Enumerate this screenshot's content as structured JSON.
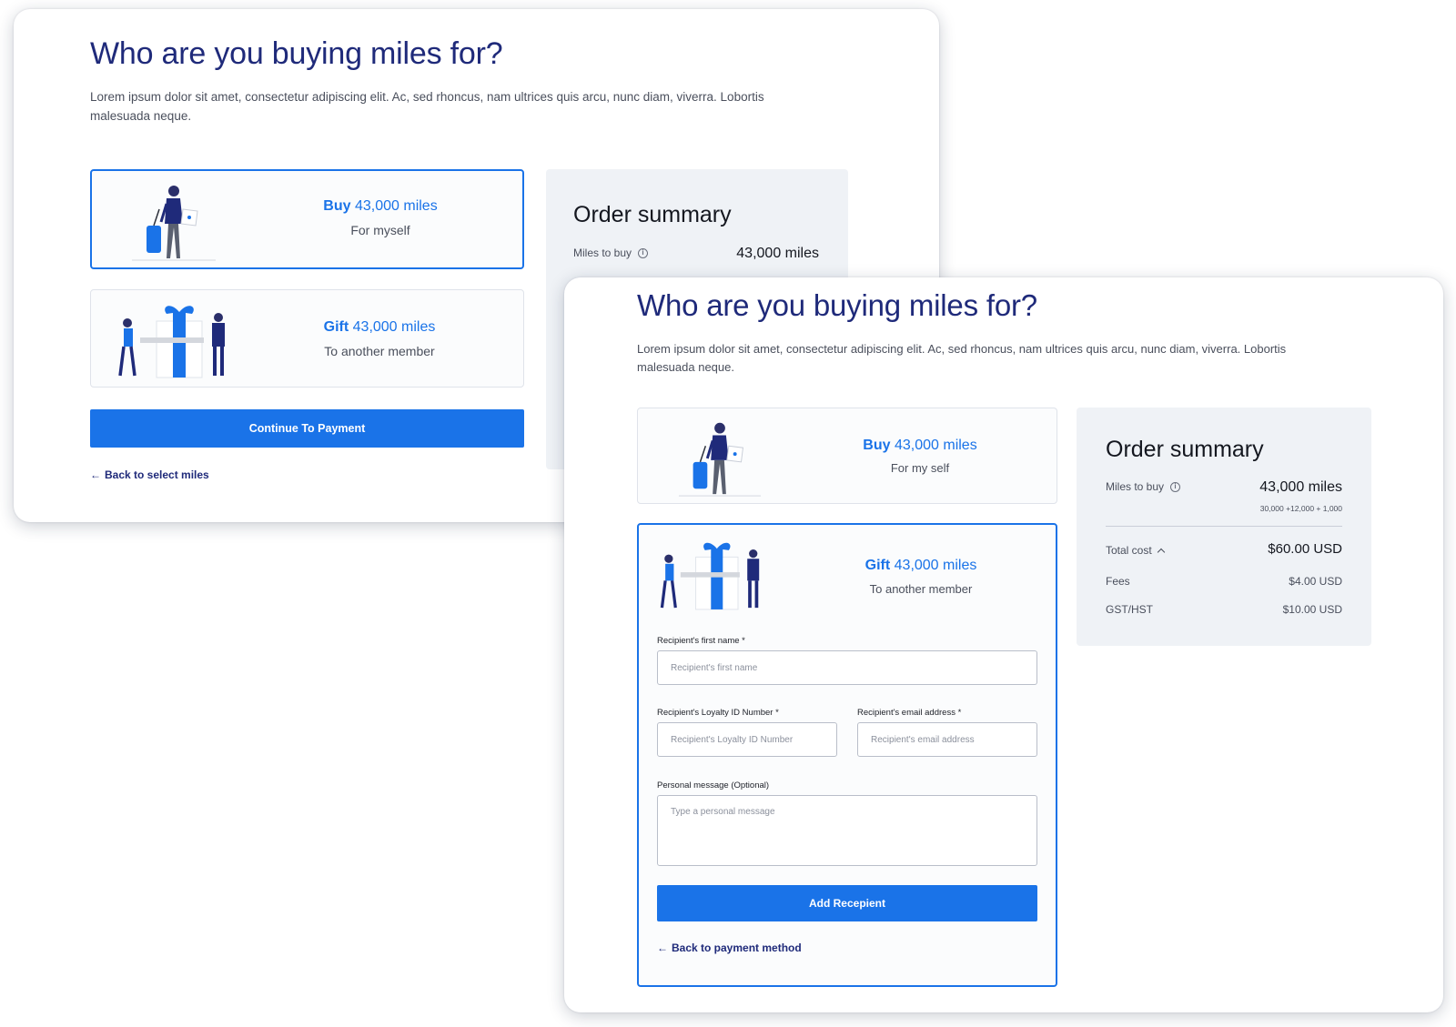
{
  "screen_a": {
    "heading": "Who are you buying miles for?",
    "intro": "Lorem ipsum dolor sit amet, consectetur adipiscing elit. Ac, sed rhoncus, nam ultrices quis arcu, nunc diam, viverra. Lobortis malesuada neque.",
    "options": [
      {
        "action": "Buy",
        "amount": "43,000 miles",
        "subtitle": "For  myself",
        "selected": true
      },
      {
        "action": "Gift",
        "amount": "43,000 miles",
        "subtitle": "To another member",
        "selected": false
      }
    ],
    "continue_label": "Continue To Payment",
    "back_label": "Back to select miles",
    "summary": {
      "title": "Order summary",
      "miles_label": "Miles to buy",
      "miles_value": "43,000 miles"
    }
  },
  "screen_b": {
    "heading": "Who are you buying miles for?",
    "intro": "Lorem ipsum dolor sit amet, consectetur adipiscing elit. Ac, sed rhoncus, nam ultrices quis arcu, nunc diam, viverra. Lobortis malesuada neque.",
    "options": [
      {
        "action": "Buy",
        "amount": "43,000 miles",
        "subtitle": "For  my self",
        "selected": false
      },
      {
        "action": "Gift",
        "amount": "43,000 miles",
        "subtitle": "To another member",
        "selected": true
      }
    ],
    "form": {
      "first_name_label": "Recipient's first name *",
      "first_name_placeholder": "Recipient's first name",
      "loyalty_label": "Recipient's Loyalty ID Number *",
      "loyalty_placeholder": "Recipient's Loyalty ID Number",
      "email_label": "Recipient's email address *",
      "email_placeholder": "Recipient's email address",
      "message_label": "Personal message (Optional)",
      "message_placeholder": "Type a personal message",
      "submit_label": "Add Recepient"
    },
    "back_label": "Back to payment method",
    "summary": {
      "title": "Order summary",
      "miles_label": "Miles to buy",
      "miles_value": "43,000 miles",
      "miles_breakdown": "30,000 +12,000 + 1,000",
      "total_label": "Total cost",
      "total_value": "$60.00 USD",
      "fees_label": "Fees",
      "fees_value": "$4.00 USD",
      "tax_label": "GST/HST",
      "tax_value": "$10.00 USD"
    }
  },
  "icons": {
    "info": "info-icon",
    "back_arrow": "arrow-left-icon",
    "total_toggle": "chevron-up-icon"
  },
  "colors": {
    "accent": "#1a73e8",
    "heading": "#1f2a7a",
    "summary_bg": "#eff2f6"
  }
}
